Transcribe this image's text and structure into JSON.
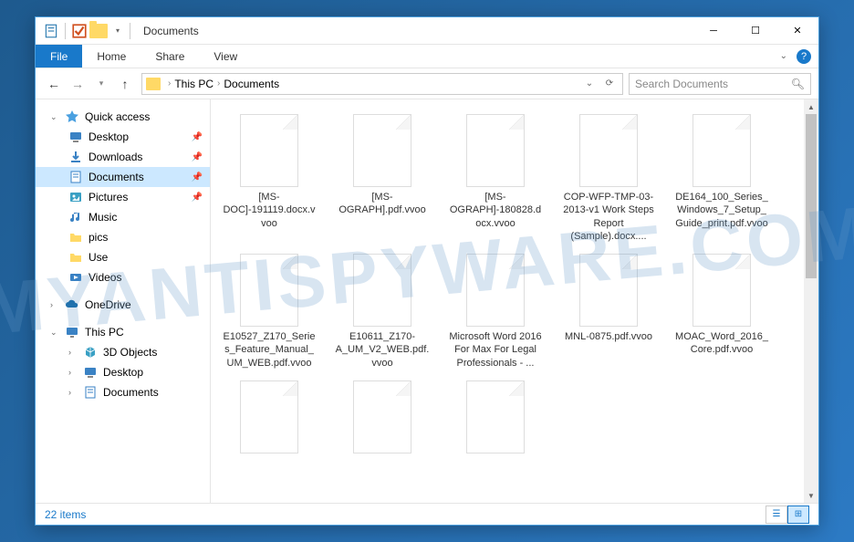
{
  "watermark": "MYANTISPYWARE.COM",
  "title": "Documents",
  "ribbon": {
    "file": "File",
    "tabs": [
      "Home",
      "Share",
      "View"
    ]
  },
  "nav": {
    "breadcrumb": [
      "This PC",
      "Documents"
    ],
    "search_placeholder": "Search Documents"
  },
  "tree": {
    "quick_access": {
      "label": "Quick access",
      "items": [
        {
          "label": "Desktop",
          "icon": "desktop",
          "pinned": true
        },
        {
          "label": "Downloads",
          "icon": "downloads",
          "pinned": true
        },
        {
          "label": "Documents",
          "icon": "documents",
          "pinned": true,
          "selected": true
        },
        {
          "label": "Pictures",
          "icon": "pictures",
          "pinned": true
        },
        {
          "label": "Music",
          "icon": "music",
          "pinned": false
        },
        {
          "label": "pics",
          "icon": "folder",
          "pinned": false
        },
        {
          "label": "Use",
          "icon": "folder",
          "pinned": false
        },
        {
          "label": "Videos",
          "icon": "videos",
          "pinned": false
        }
      ]
    },
    "onedrive": {
      "label": "OneDrive"
    },
    "this_pc": {
      "label": "This PC",
      "items": [
        {
          "label": "3D Objects",
          "icon": "3d"
        },
        {
          "label": "Desktop",
          "icon": "desktop"
        },
        {
          "label": "Documents",
          "icon": "documents"
        }
      ]
    }
  },
  "files": [
    {
      "name": "[MS-DOC]-191119.docx.vvoo"
    },
    {
      "name": "[MS-OGRAPH].pdf.vvoo"
    },
    {
      "name": "[MS-OGRAPH]-180828.docx.vvoo"
    },
    {
      "name": "COP-WFP-TMP-03-2013-v1 Work Steps Report (Sample).docx...."
    },
    {
      "name": "DE164_100_Series_Windows_7_Setup_Guide_print.pdf.vvoo"
    },
    {
      "name": "E10527_Z170_Series_Feature_Manual_UM_WEB.pdf.vvoo"
    },
    {
      "name": "E10611_Z170-A_UM_V2_WEB.pdf.vvoo"
    },
    {
      "name": "Microsoft Word 2016 For Max For Legal Professionals - ..."
    },
    {
      "name": "MNL-0875.pdf.vvoo"
    },
    {
      "name": "MOAC_Word_2016_Core.pdf.vvoo"
    },
    {
      "name": ""
    },
    {
      "name": ""
    },
    {
      "name": ""
    }
  ],
  "status": {
    "count_label": "22 items"
  }
}
